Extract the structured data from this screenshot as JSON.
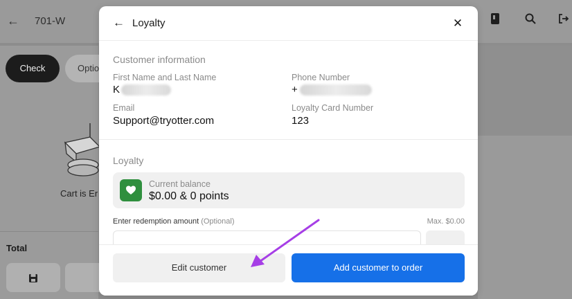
{
  "background": {
    "order_name": "701-W",
    "tabs": [
      {
        "label": "Check"
      },
      {
        "label": "Optio"
      }
    ],
    "cart_empty_text": "Cart is Er",
    "total_label": "Total"
  },
  "modal": {
    "title": "Loyalty",
    "customer_section_label": "Customer information",
    "fields": {
      "name": {
        "label": "First Name and Last Name",
        "value": "K"
      },
      "phone": {
        "label": "Phone Number",
        "value": "+"
      },
      "email": {
        "label": "Email",
        "value": "Support@tryotter.com"
      },
      "loyalty_card": {
        "label": "Loyalty Card Number",
        "value": "123"
      }
    },
    "loyalty_section_label": "Loyalty",
    "balance": {
      "label": "Current balance",
      "value": "$0.00 & 0 points"
    },
    "redemption": {
      "label": "Enter redemption amount",
      "optional": "(Optional)",
      "max": "Max. $0.00"
    },
    "buttons": {
      "edit": "Edit customer",
      "add": "Add customer to order"
    }
  },
  "colors": {
    "primary_button": "#1670e8",
    "loyalty_icon_bg": "#2f8f3e",
    "annotation_arrow": "#a63ee6"
  },
  "icons": {
    "back": "arrow-left-icon",
    "close": "close-icon",
    "search": "search-icon",
    "logout": "logout-icon",
    "loyalty": "heart-icon",
    "save": "save-icon"
  }
}
